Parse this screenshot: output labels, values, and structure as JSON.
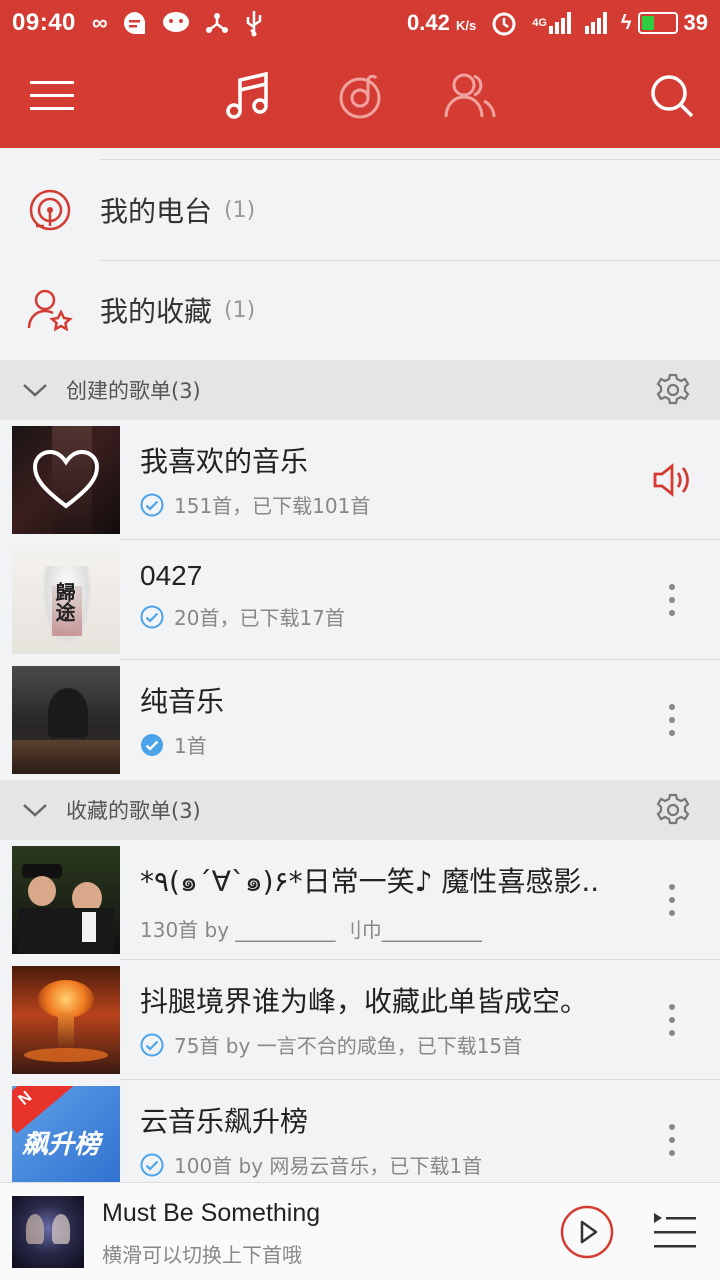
{
  "status": {
    "time": "09:40",
    "speed": "0.42",
    "speed_unit": "K/s",
    "net": "4G",
    "battery": "39"
  },
  "nav": {
    "icons": [
      "menu-icon",
      "music-note-icon",
      "netease-logo-icon",
      "friends-icon",
      "search-icon"
    ]
  },
  "menu": [
    {
      "label": "我的电台",
      "count": "(1)"
    },
    {
      "label": "我的收藏",
      "count": "(1)"
    }
  ],
  "created_section": {
    "title": "创建的歌单(3)"
  },
  "created": [
    {
      "name": "我喜欢的音乐",
      "sub": "151首，已下载101首"
    },
    {
      "name": "0427",
      "sub": "20首，已下载17首"
    },
    {
      "name": "纯音乐",
      "sub": "1首"
    }
  ],
  "collected_section": {
    "title": "收藏的歌单(3)"
  },
  "collected": [
    {
      "name": "*٩(๑´∀`๑)۶*日常一笑♪ 魔性喜感影..",
      "sub": "130首 by __________ 刂巾__________"
    },
    {
      "name": "抖腿境界谁为峰，收藏此单皆成空。",
      "sub": "75首 by 一言不合的咸鱼，已下载15首"
    },
    {
      "name": "云音乐飙升榜",
      "sub": "100首 by 网易云音乐，已下载1首",
      "cover_text": "飙升榜",
      "badge": "N"
    }
  ],
  "player": {
    "song": "Must Be Something",
    "hint": "横滑可以切换上下首哦"
  },
  "colors": {
    "brand": "#d43c33",
    "check": "#4aa3e8"
  }
}
